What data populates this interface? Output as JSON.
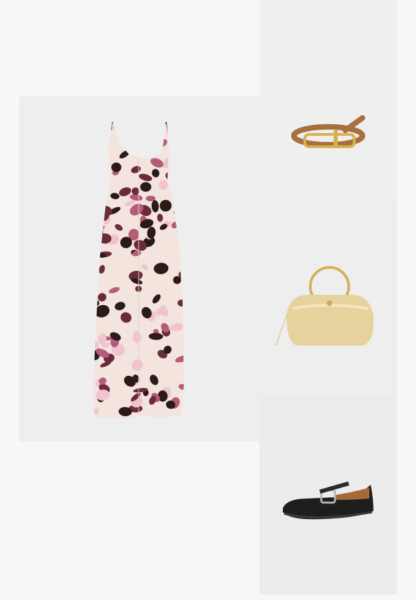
{
  "products": [
    {
      "id": "dress",
      "kind": "leopard-print-maxi-dress",
      "colors": [
        "#f3e4dd",
        "#2b1a1a",
        "#b45c7a"
      ]
    },
    {
      "id": "belt",
      "kind": "tan-leather-belt",
      "colors": [
        "#b07a4a",
        "#d9b25a"
      ]
    },
    {
      "id": "bag",
      "kind": "gold-ring-handle-clutch",
      "colors": [
        "#e3cf95",
        "#c9aa60"
      ]
    },
    {
      "id": "shoes",
      "kind": "black-mary-jane-flats",
      "colors": [
        "#1e1e1e",
        "#a56a3a"
      ]
    }
  ]
}
